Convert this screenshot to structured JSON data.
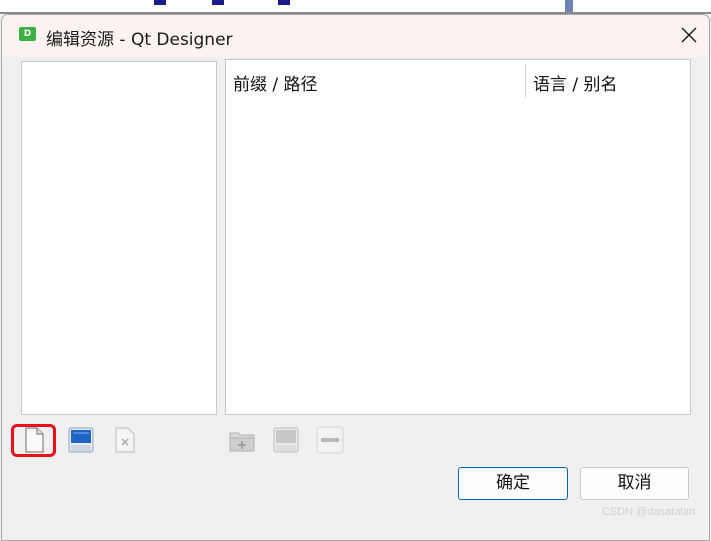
{
  "window": {
    "title": "编辑资源 - Qt Designer",
    "app_icon_letter": "D"
  },
  "table": {
    "columns": [
      "前缀 / 路径",
      "语言 / 别名"
    ]
  },
  "left_toolbar": {
    "icons": [
      "new-file-icon",
      "save-icon",
      "remove-file-icon"
    ]
  },
  "right_toolbar": {
    "icons": [
      "add-folder-icon",
      "add-file-icon",
      "remove-icon"
    ]
  },
  "buttons": {
    "ok": "确定",
    "cancel": "取消"
  },
  "watermark": "CSDN @dasatalan",
  "colors": {
    "highlight": "#e8121a",
    "ok_border": "#0067c0",
    "titlebar": "#fbf3f1"
  }
}
